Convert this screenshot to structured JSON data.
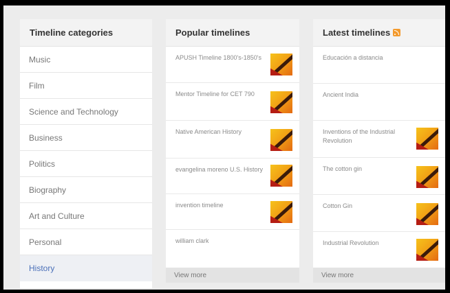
{
  "categories": {
    "title": "Timeline categories",
    "items": [
      {
        "label": "Music"
      },
      {
        "label": "Film"
      },
      {
        "label": "Science and Technology"
      },
      {
        "label": "Business"
      },
      {
        "label": "Politics"
      },
      {
        "label": "Biography"
      },
      {
        "label": "Art and Culture"
      },
      {
        "label": "Personal"
      },
      {
        "label": "History"
      }
    ],
    "active_index": 8
  },
  "popular": {
    "title": "Popular timelines",
    "items": [
      {
        "label": "APUSH Timeline 1800's-1850's",
        "has_thumb": true
      },
      {
        "label": "Mentor Timeline for CET 790",
        "has_thumb": true
      },
      {
        "label": "Native American History",
        "has_thumb": true
      },
      {
        "label": "evangelina moreno U.S. History",
        "has_thumb": true
      },
      {
        "label": "invention timeline",
        "has_thumb": true
      },
      {
        "label": "william clark",
        "has_thumb": false
      }
    ],
    "view_more": "View more"
  },
  "latest": {
    "title": "Latest timelines",
    "rss_icon": "rss-feed-icon",
    "items": [
      {
        "label": "Educación a distancia",
        "has_thumb": false
      },
      {
        "label": "Ancient India",
        "has_thumb": false
      },
      {
        "label": "Inventions of the Industrial Revolution",
        "has_thumb": true
      },
      {
        "label": "The cotton gin",
        "has_thumb": true
      },
      {
        "label": "Cotton Gin",
        "has_thumb": true
      },
      {
        "label": "Industrial Revolution",
        "has_thumb": true
      }
    ],
    "view_more": "View more"
  },
  "colors": {
    "active_category": "#4a6fb8",
    "rss": "#f39a2d",
    "thumb_primary": "#f6c21b",
    "thumb_accent": "#b51d13"
  }
}
